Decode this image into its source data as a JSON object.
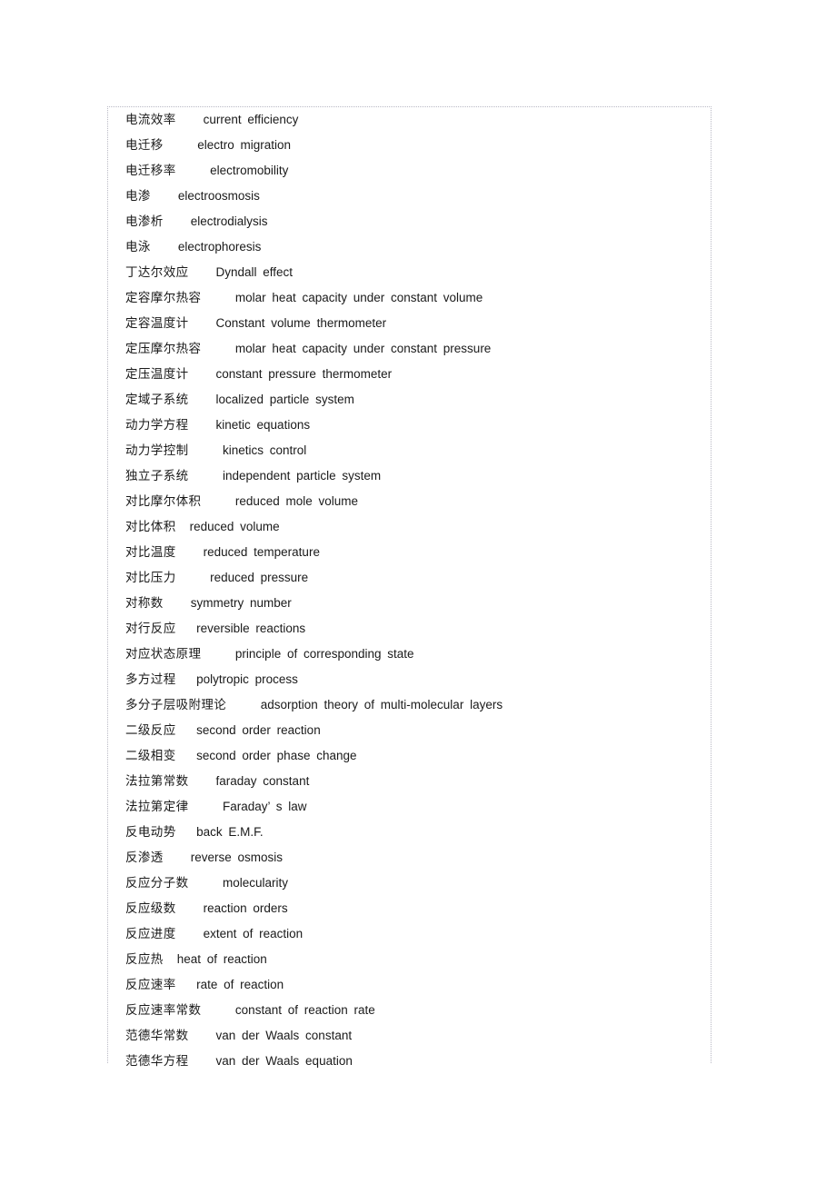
{
  "document": {
    "kind": "glossary-page",
    "language_pair": "Chinese-English",
    "subject": "physical-chemistry-terms",
    "entry_count": 38,
    "entries": [
      {
        "term": "电流效率",
        "gap": 4,
        "definition": "current   efficiency"
      },
      {
        "term": "电迁移",
        "gap": 5,
        "definition": "electro   migration"
      },
      {
        "term": "电迁移率",
        "gap": 5,
        "definition": "electromobility"
      },
      {
        "term": "电渗",
        "gap": 4,
        "definition": "electroosmosis"
      },
      {
        "term": "电渗析",
        "gap": 4,
        "definition": "electrodialysis"
      },
      {
        "term": "电泳",
        "gap": 4,
        "definition": "electrophoresis"
      },
      {
        "term": "丁达尔效应",
        "gap": 4,
        "definition": "Dyndall   effect"
      },
      {
        "term": "定容摩尔热容",
        "gap": 5,
        "definition": "molar   heat   capacity   under   constant   volume"
      },
      {
        "term": "定容温度计",
        "gap": 4,
        "definition": "Constant   volume   thermometer"
      },
      {
        "term": "定压摩尔热容",
        "gap": 5,
        "definition": "molar   heat   capacity   under   constant   pressure"
      },
      {
        "term": "定压温度计",
        "gap": 4,
        "definition": "constant   pressure   thermometer"
      },
      {
        "term": "定域子系统",
        "gap": 4,
        "definition": "localized   particle   system"
      },
      {
        "term": "动力学方程",
        "gap": 4,
        "definition": "kinetic   equations"
      },
      {
        "term": "动力学控制",
        "gap": 5,
        "definition": "kinetics   control"
      },
      {
        "term": "独立子系统",
        "gap": 5,
        "definition": "independent   particle   system"
      },
      {
        "term": "对比摩尔体积",
        "gap": 5,
        "definition": "reduced   mole   volume"
      },
      {
        "term": "对比体积",
        "gap": 2,
        "definition": "reduced   volume"
      },
      {
        "term": "对比温度",
        "gap": 4,
        "definition": "reduced   temperature"
      },
      {
        "term": "对比压力",
        "gap": 5,
        "definition": "reduced   pressure"
      },
      {
        "term": "对称数",
        "gap": 4,
        "definition": "symmetry   number"
      },
      {
        "term": "对行反应",
        "gap": 3,
        "definition": "reversible   reactions"
      },
      {
        "term": "对应状态原理",
        "gap": 5,
        "definition": "principle   of corresponding   state"
      },
      {
        "term": "多方过程",
        "gap": 3,
        "definition": "polytropic   process"
      },
      {
        "term": "多分子层吸附理论",
        "gap": 5,
        "definition": "adsorption   theory   of multi-molecular   layers"
      },
      {
        "term": "二级反应",
        "gap": 3,
        "definition": "second   order   reaction"
      },
      {
        "term": "二级相变",
        "gap": 3,
        "definition": "second   order   phase   change"
      },
      {
        "term": "法拉第常数",
        "gap": 4,
        "definition": "faraday   constant"
      },
      {
        "term": "法拉第定律",
        "gap": 5,
        "definition": "Faraday’ s law"
      },
      {
        "term": "反电动势",
        "gap": 3,
        "definition": "back   E.M.F."
      },
      {
        "term": "反渗透",
        "gap": 4,
        "definition": "reverse   osmosis"
      },
      {
        "term": "反应分子数",
        "gap": 5,
        "definition": "molecularity"
      },
      {
        "term": "反应级数",
        "gap": 4,
        "definition": "reaction   orders"
      },
      {
        "term": "反应进度",
        "gap": 4,
        "definition": "extent   of  reaction"
      },
      {
        "term": "反应热",
        "gap": 2,
        "definition": "heat   of  reaction"
      },
      {
        "term": "反应速率",
        "gap": 3,
        "definition": "rate   of  reaction"
      },
      {
        "term": "反应速率常数",
        "gap": 5,
        "definition": "constant   of reaction   rate"
      },
      {
        "term": "范德华常数",
        "gap": 4,
        "definition": "van   der   Waals   constant"
      },
      {
        "term": "范德华方程",
        "gap": 4,
        "definition": "van   der   Waals   equation"
      }
    ]
  }
}
